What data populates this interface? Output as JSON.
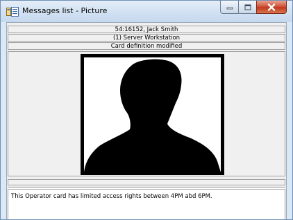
{
  "window": {
    "title": "Messages list - Picture",
    "icon": "messages-list-icon",
    "buttons": {
      "minimize": "minimize-icon",
      "maximize": "maximize-icon",
      "close": "close-icon"
    }
  },
  "header": {
    "card_holder": "54:16152, Jack Smith",
    "workstation": "(1) Server Workstation",
    "event": "Card definition modified"
  },
  "picture": {
    "description_icon": "person-silhouette"
  },
  "message": {
    "text": "This Operator card has limited access rights between 4PM abd 6PM."
  },
  "colors": {
    "titlebar": "#d3e2f3",
    "close_button": "#c13a1f",
    "panel": "#f0f0f0",
    "photo_border": "#000000"
  }
}
